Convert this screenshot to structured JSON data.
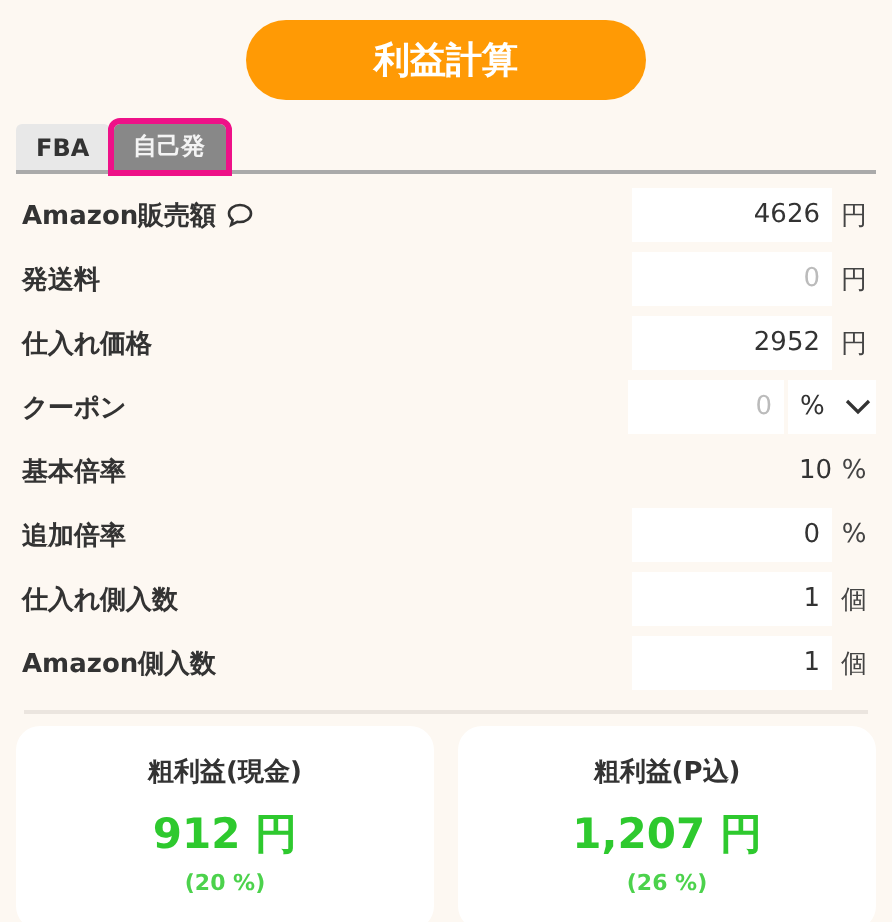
{
  "action_button": {
    "label": "利益計算"
  },
  "tabs": [
    {
      "label": "FBA",
      "selected": false
    },
    {
      "label": "自己発",
      "selected": true
    }
  ],
  "fields": [
    {
      "kind": "input",
      "label": "Amazon販売額",
      "has_comment": true,
      "value": "4626",
      "unit": "円"
    },
    {
      "kind": "input",
      "label": "発送料",
      "placeholder": "0",
      "unit": "円"
    },
    {
      "kind": "input",
      "label": "仕入れ価格",
      "value": "2952",
      "unit": "円"
    },
    {
      "kind": "select",
      "label": "クーポン",
      "placeholder": "0",
      "unit": "%"
    },
    {
      "kind": "static",
      "label": "基本倍率",
      "value": "10",
      "unit": "%"
    },
    {
      "kind": "input",
      "label": "追加倍率",
      "value": "0",
      "unit": "%"
    },
    {
      "kind": "input",
      "label": "仕入れ側入数",
      "value": "1",
      "unit": "個"
    },
    {
      "kind": "input",
      "label": "Amazon側入数",
      "value": "1",
      "unit": "個"
    }
  ],
  "results": [
    {
      "title": "粗利益(現金)",
      "amount": "912 円",
      "rate": "(20 %)"
    },
    {
      "title": "粗利益(P込)",
      "amount": "1,207 円",
      "rate": "(26 %)"
    }
  ]
}
